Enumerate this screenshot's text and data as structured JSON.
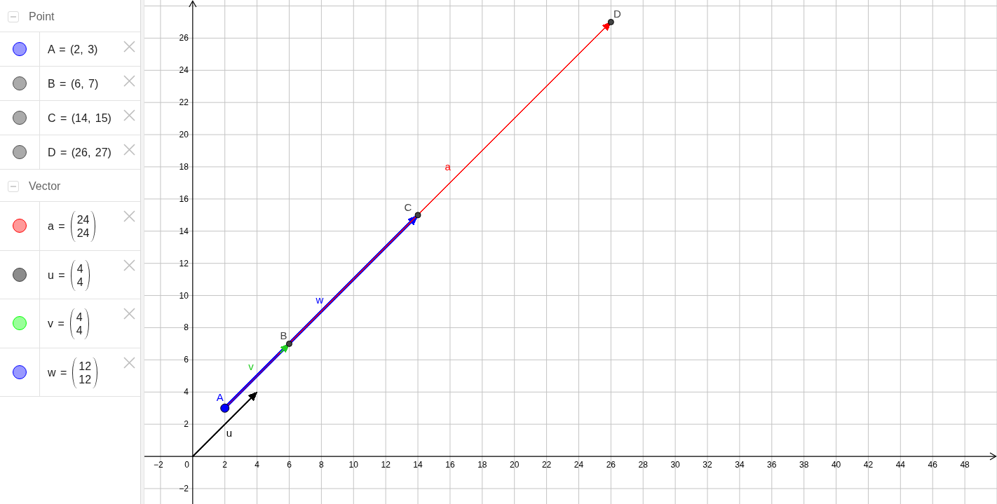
{
  "algebra_view": {
    "groups": [
      {
        "title": "Point",
        "expanded": true,
        "items": [
          {
            "kind": "point",
            "text": "A = (2, 3)",
            "color": "#9999ff"
          },
          {
            "kind": "point",
            "text": "B = (6, 7)",
            "color": "#aaaaaa"
          },
          {
            "kind": "point",
            "text": "C = (14, 15)",
            "color": "#aaaaaa"
          },
          {
            "kind": "point",
            "text": "D = (26, 27)",
            "color": "#aaaaaa"
          }
        ]
      },
      {
        "title": "Vector",
        "expanded": true,
        "items": [
          {
            "kind": "vector",
            "label": "a =",
            "components": [
              "24",
              "24"
            ],
            "color": "#ff9999"
          },
          {
            "kind": "vector",
            "label": "u =",
            "components": [
              "4",
              "4"
            ],
            "color": "#8c8c8c"
          },
          {
            "kind": "vector",
            "label": "v =",
            "components": [
              "4",
              "4"
            ],
            "color": "#99ff99"
          },
          {
            "kind": "vector",
            "label": "w =",
            "components": [
              "12",
              "12"
            ],
            "color": "#9999ff"
          }
        ]
      }
    ]
  },
  "graphics": {
    "chart_data": {
      "type": "scatter",
      "grid": true,
      "xlim": [
        -3,
        50
      ],
      "ylim": [
        -2.96,
        28.37
      ],
      "xticks": [
        {
          "value": -2,
          "label": "−2"
        },
        0,
        2,
        4,
        6,
        8,
        10,
        12,
        14,
        16,
        18,
        20,
        22,
        24,
        26,
        28,
        30,
        32,
        34,
        36,
        38,
        40,
        42,
        44,
        46,
        48
      ],
      "yticks": [
        {
          "value": -2,
          "label": "−2"
        },
        2,
        4,
        6,
        8,
        10,
        12,
        14,
        16,
        18,
        20,
        22,
        24,
        26
      ],
      "x": [
        2,
        6,
        14,
        26
      ],
      "series": [
        {
          "name": "A",
          "color": "#0000ff",
          "values": [
            3,
            null,
            null,
            null
          ]
        },
        {
          "name": "B",
          "color": "#444444",
          "values": [
            null,
            7,
            null,
            null
          ]
        },
        {
          "name": "C",
          "color": "#444444",
          "values": [
            null,
            null,
            15,
            null
          ]
        },
        {
          "name": "D",
          "color": "#444444",
          "values": [
            null,
            null,
            null,
            27
          ]
        }
      ]
    },
    "vectors": [
      {
        "label": "u",
        "color": "#000000"
      },
      {
        "label": "w",
        "color": "#0000ff"
      },
      {
        "label": "a",
        "color": "#ff0000"
      },
      {
        "label": "v",
        "color": "#22cc22"
      }
    ]
  }
}
